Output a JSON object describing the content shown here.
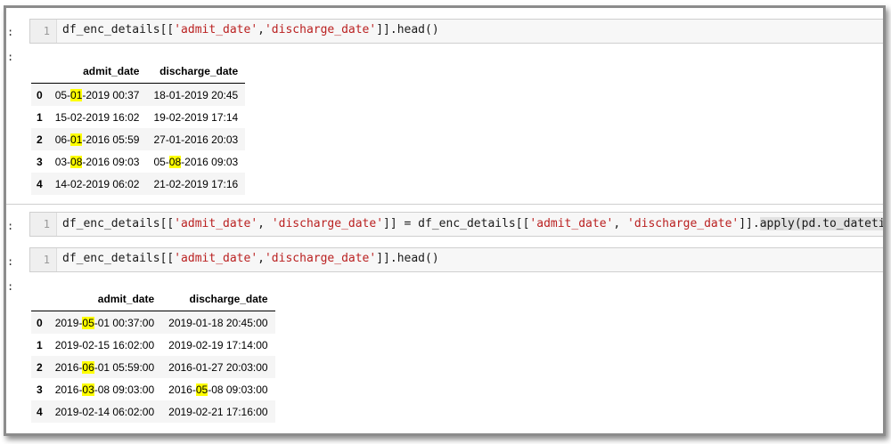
{
  "prompt_marker": ":",
  "cells": [
    {
      "line": "1",
      "code": [
        {
          "t": "df_enc_details[[",
          "c": ""
        },
        {
          "t": "'admit_date'",
          "c": "str"
        },
        {
          "t": ",",
          "c": ""
        },
        {
          "t": "'discharge_date'",
          "c": "str"
        },
        {
          "t": "]].head()",
          "c": ""
        }
      ]
    },
    {
      "line": "1",
      "code": [
        {
          "t": "df_enc_details[[",
          "c": ""
        },
        {
          "t": "'admit_date'",
          "c": "str"
        },
        {
          "t": ", ",
          "c": ""
        },
        {
          "t": "'discharge_date'",
          "c": "str"
        },
        {
          "t": "]] = df_enc_details[[",
          "c": ""
        },
        {
          "t": "'admit_date'",
          "c": "str"
        },
        {
          "t": ", ",
          "c": ""
        },
        {
          "t": "'discharge_date'",
          "c": "str"
        },
        {
          "t": "]].",
          "c": ""
        },
        {
          "t": "apply(pd.to_datetime)",
          "c": "hl-code"
        }
      ]
    },
    {
      "line": "1",
      "code": [
        {
          "t": "df_enc_details[[",
          "c": ""
        },
        {
          "t": "'admit_date'",
          "c": "str"
        },
        {
          "t": ",",
          "c": ""
        },
        {
          "t": "'discharge_date'",
          "c": "str"
        },
        {
          "t": "]].head()",
          "c": ""
        }
      ]
    }
  ],
  "output1": {
    "columns": [
      "",
      "admit_date",
      "discharge_date"
    ],
    "rows": [
      [
        "0",
        [
          "05-",
          "01",
          "-2019 00:37"
        ],
        [
          "18-01-2019 20:45"
        ]
      ],
      [
        "1",
        [
          "15-02-2019 16:02"
        ],
        [
          "19-02-2019 17:14"
        ]
      ],
      [
        "2",
        [
          "06-",
          "01",
          "-2016 05:59"
        ],
        [
          "27-01-2016 20:03"
        ]
      ],
      [
        "3",
        [
          "03-",
          "08",
          "-2016 09:03"
        ],
        [
          "05-",
          "08",
          "-2016 09:03"
        ]
      ],
      [
        "4",
        [
          "14-02-2019 06:02"
        ],
        [
          "21-02-2019 17:16"
        ]
      ]
    ]
  },
  "output2": {
    "columns": [
      "",
      "admit_date",
      "discharge_date"
    ],
    "rows": [
      [
        "0",
        [
          "2019-",
          "05",
          "-01 00:37:00"
        ],
        [
          "2019-01-18 20:45:00"
        ]
      ],
      [
        "1",
        [
          "2019-02-15 16:02:00"
        ],
        [
          "2019-02-19 17:14:00"
        ]
      ],
      [
        "2",
        [
          "2016-",
          "06",
          "-01 05:59:00"
        ],
        [
          "2016-01-27 20:03:00"
        ]
      ],
      [
        "3",
        [
          "2016-",
          "03",
          "-08 09:03:00"
        ],
        [
          "2016-",
          "05",
          "-08 09:03:00"
        ]
      ],
      [
        "4",
        [
          "2019-02-14 06:02:00"
        ],
        [
          "2019-02-21 17:16:00"
        ]
      ]
    ]
  }
}
